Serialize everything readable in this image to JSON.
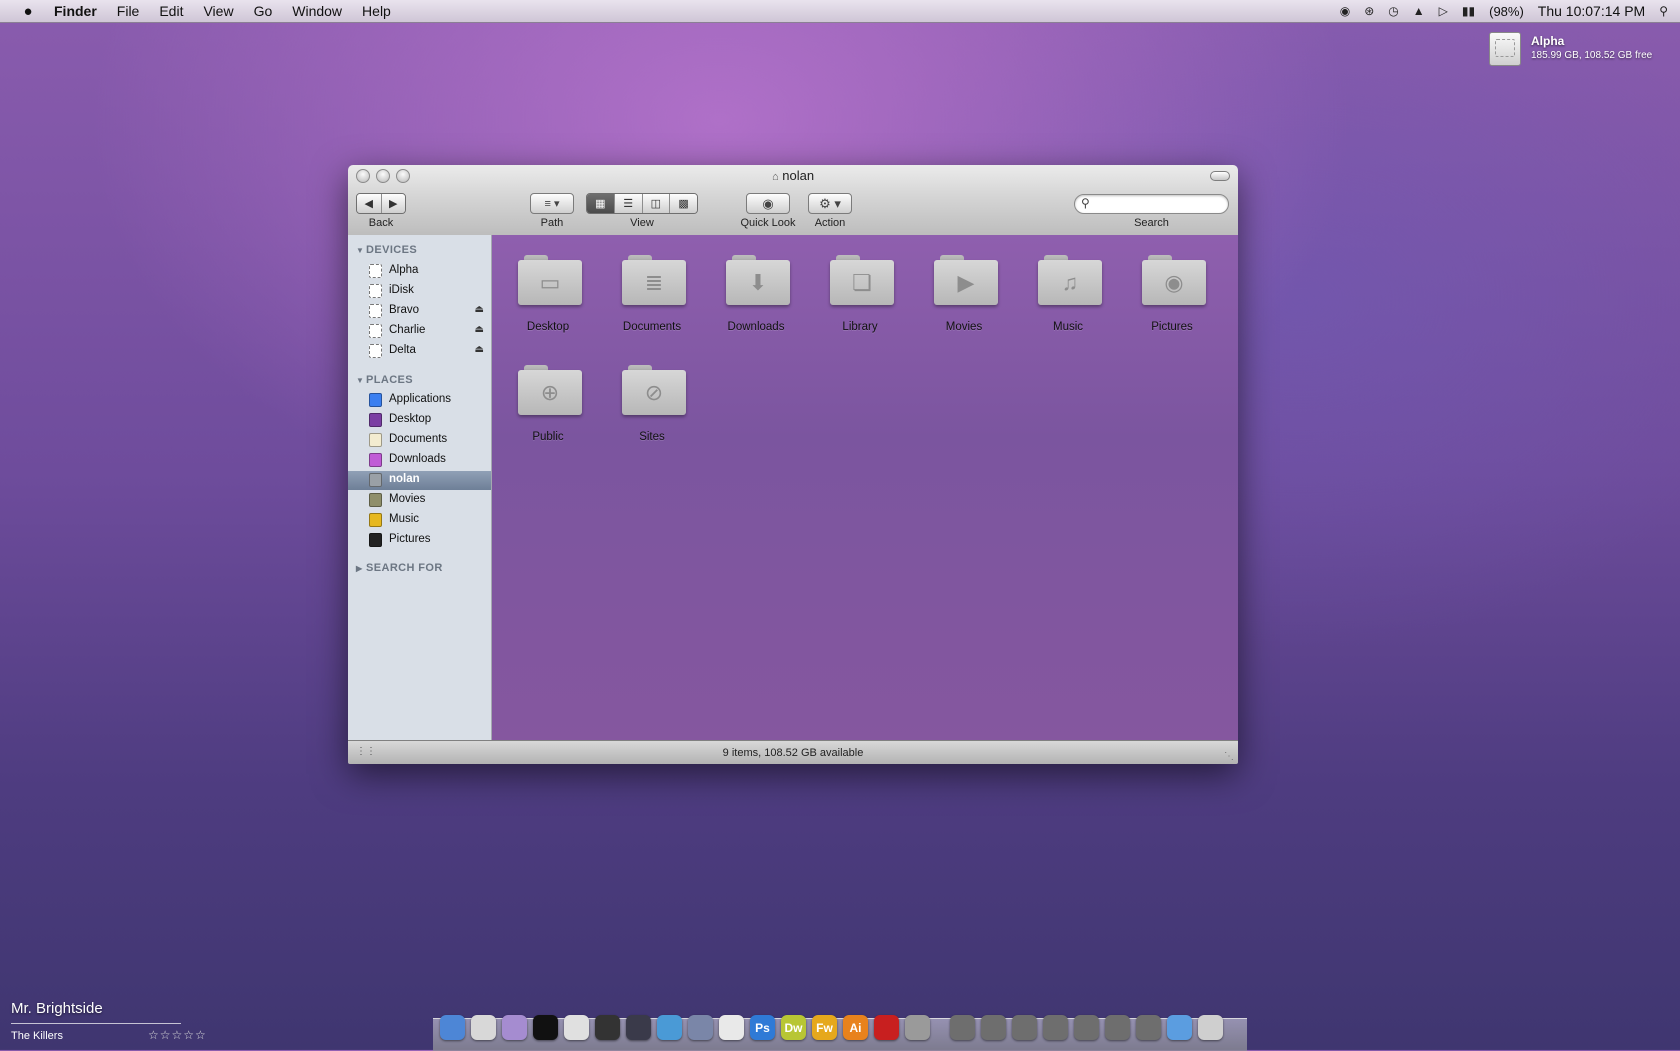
{
  "menubar": {
    "apple_icon": "apple-icon",
    "items": [
      "Finder",
      "File",
      "Edit",
      "View",
      "Go",
      "Window",
      "Help"
    ],
    "status_icons": [
      "airport-display-icon",
      "bluetooth-icon",
      "time-machine-icon",
      "wifi-icon",
      "volume-icon",
      "battery-icon"
    ],
    "battery": "(98%)",
    "clock": "Thu 10:07:14 PM",
    "spotlight_icon": "spotlight-icon"
  },
  "desktop_drive": {
    "name": "Alpha",
    "info": "185.99 GB, 108.52 GB free"
  },
  "window": {
    "title": "nolan",
    "toolbar": {
      "back_label": "Back",
      "path_label": "Path",
      "view_label": "View",
      "quicklook_label": "Quick Look",
      "action_label": "Action",
      "search_label": "Search",
      "search_value": "",
      "active_view": "icon"
    },
    "sidebar": {
      "devices_header": "DEVICES",
      "devices": [
        {
          "label": "Alpha",
          "eject": false
        },
        {
          "label": "iDisk",
          "eject": false
        },
        {
          "label": "Bravo",
          "eject": true
        },
        {
          "label": "Charlie",
          "eject": true
        },
        {
          "label": "Delta",
          "eject": true
        }
      ],
      "places_header": "PLACES",
      "places": [
        {
          "label": "Applications",
          "color": "#3b7ff0"
        },
        {
          "label": "Desktop",
          "color": "#7b3fa3"
        },
        {
          "label": "Documents",
          "color": "#f3ecd0"
        },
        {
          "label": "Downloads",
          "color": "#c05bd6"
        },
        {
          "label": "nolan",
          "color": "#9aa0a6",
          "selected": true
        },
        {
          "label": "Movies",
          "color": "#8f8f6a"
        },
        {
          "label": "Music",
          "color": "#e6b820"
        },
        {
          "label": "Pictures",
          "color": "#222222"
        }
      ],
      "search_header": "SEARCH FOR"
    },
    "files": [
      {
        "name": "Desktop",
        "icon": "desktop-folder-icon",
        "glyph": "▭"
      },
      {
        "name": "Documents",
        "icon": "documents-folder-icon",
        "glyph": "≣"
      },
      {
        "name": "Downloads",
        "icon": "downloads-folder-icon",
        "glyph": "⬇"
      },
      {
        "name": "Library",
        "icon": "library-folder-icon",
        "glyph": "❏"
      },
      {
        "name": "Movies",
        "icon": "movies-folder-icon",
        "glyph": "▶"
      },
      {
        "name": "Music",
        "icon": "music-folder-icon",
        "glyph": "♫"
      },
      {
        "name": "Pictures",
        "icon": "pictures-folder-icon",
        "glyph": "◉"
      },
      {
        "name": "Public",
        "icon": "public-folder-icon",
        "glyph": "⊕"
      },
      {
        "name": "Sites",
        "icon": "sites-folder-icon",
        "glyph": "⊘"
      }
    ],
    "status": "9 items, 108.52 GB available"
  },
  "now_playing": {
    "title": "Mr. Brightside",
    "artist": "The Killers",
    "rating": "☆☆☆☆☆"
  },
  "dock": {
    "apps": [
      {
        "icon": "finder-icon",
        "color": "#4d86d6",
        "glyph": ""
      },
      {
        "icon": "mail-icon",
        "color": "#d8d8d8",
        "glyph": ""
      },
      {
        "icon": "itunes-icon",
        "color": "#a58cd0",
        "glyph": ""
      },
      {
        "icon": "suit-app-icon",
        "color": "#111111",
        "glyph": ""
      },
      {
        "icon": "headphones-icon",
        "color": "#e0e0e0",
        "glyph": ""
      },
      {
        "icon": "camera-icon",
        "color": "#333333",
        "glyph": ""
      },
      {
        "icon": "lens-icon",
        "color": "#3a3a4a",
        "glyph": ""
      },
      {
        "icon": "chart-app-icon",
        "color": "#4a9ad6",
        "glyph": ""
      },
      {
        "icon": "pen-app-icon",
        "color": "#7a86a8",
        "glyph": ""
      },
      {
        "icon": "notes-app-icon",
        "color": "#e9e9e9",
        "glyph": ""
      },
      {
        "icon": "photoshop-icon",
        "color": "#2f7ad6",
        "glyph": "Ps"
      },
      {
        "icon": "dreamweaver-icon",
        "color": "#b8c634",
        "glyph": "Dw"
      },
      {
        "icon": "fireworks-icon",
        "color": "#e6a81c",
        "glyph": "Fw"
      },
      {
        "icon": "illustrator-icon",
        "color": "#e8821c",
        "glyph": "Ai"
      },
      {
        "icon": "acrobat-icon",
        "color": "#c81f1f",
        "glyph": ""
      },
      {
        "icon": "system-preferences-icon",
        "color": "#9a9a9a",
        "glyph": ""
      }
    ],
    "stacks": [
      {
        "icon": "stack-folder-1-icon",
        "color": "#6e6e6e"
      },
      {
        "icon": "stack-folder-2-icon",
        "color": "#6e6e6e"
      },
      {
        "icon": "stack-folder-3-icon",
        "color": "#6e6e6e"
      },
      {
        "icon": "stack-folder-4-icon",
        "color": "#6e6e6e"
      },
      {
        "icon": "stack-folder-5-icon",
        "color": "#6e6e6e"
      },
      {
        "icon": "stack-folder-6-icon",
        "color": "#6e6e6e"
      },
      {
        "icon": "stack-folder-7-icon",
        "color": "#6e6e6e"
      },
      {
        "icon": "downloads-stack-icon",
        "color": "#5b9de0"
      },
      {
        "icon": "trash-icon",
        "color": "#cfcfcf"
      }
    ]
  }
}
